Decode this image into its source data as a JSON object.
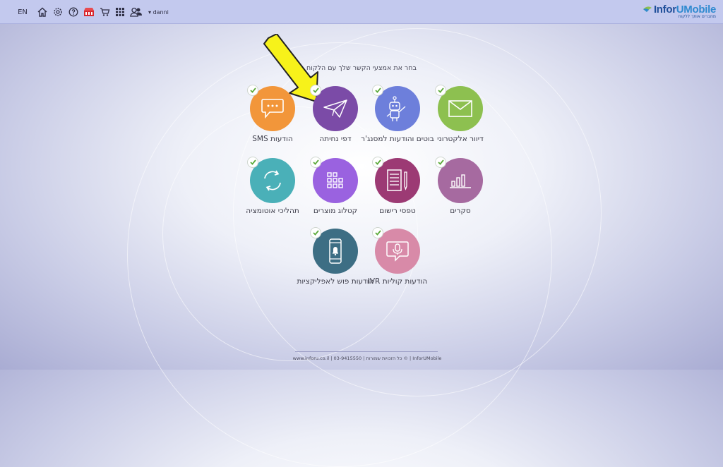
{
  "topbar": {
    "language": "EN",
    "username": "danni",
    "icons": [
      "home-icon",
      "settings-icon",
      "help-icon",
      "shop-icon",
      "cart-icon",
      "apps-grid-icon",
      "users-icon"
    ]
  },
  "logo": {
    "brand_part1": "Infor",
    "brand_part2": "UMobile",
    "tagline": "מחברים אותך ללקוח"
  },
  "title": "בחר את אמצעי הקשר שלך עם הלקוח",
  "services": [
    {
      "id": "email",
      "label": "דיוור אלקטרוני",
      "color": "#8dc050",
      "icon": "envelope-icon"
    },
    {
      "id": "bots",
      "label": "בוטים והודעות למסנג'ר",
      "color": "#6d7fdb",
      "icon": "robot-icon"
    },
    {
      "id": "landing",
      "label": "דפי נחיתה",
      "color": "#7b4ba7",
      "icon": "paper-plane-icon"
    },
    {
      "id": "sms",
      "label": "הודעות SMS",
      "color": "#f2963a",
      "icon": "chat-bubble-icon"
    },
    {
      "id": "surveys",
      "label": "סקרים",
      "color": "#a66aa0",
      "icon": "bar-chart-icon"
    },
    {
      "id": "forms",
      "label": "טפסי רישום",
      "color": "#9c3a74",
      "icon": "form-icon"
    },
    {
      "id": "catalog",
      "label": "קטלוג מוצרים",
      "color": "#9a62e0",
      "icon": "catalog-grid-icon"
    },
    {
      "id": "automation",
      "label": "תהליכי אוטומציה",
      "color": "#4ab0b8",
      "icon": "refresh-cycle-icon"
    },
    {
      "id": "ivr",
      "label": "הודעות קוליות IVR",
      "color": "#d88aa8",
      "icon": "microphone-icon"
    },
    {
      "id": "push",
      "label": "הודעות פוש לאפליקציות",
      "color": "#3d6e84",
      "icon": "phone-notification-icon"
    }
  ],
  "footer": "www.inforu.co.il | 03-9415550 | כל הזכויות שמורות © | InforUMobile",
  "colors": {
    "topbar": "#c3c9ee",
    "check": "#5caa3a",
    "arrow": "#f7f21a"
  }
}
